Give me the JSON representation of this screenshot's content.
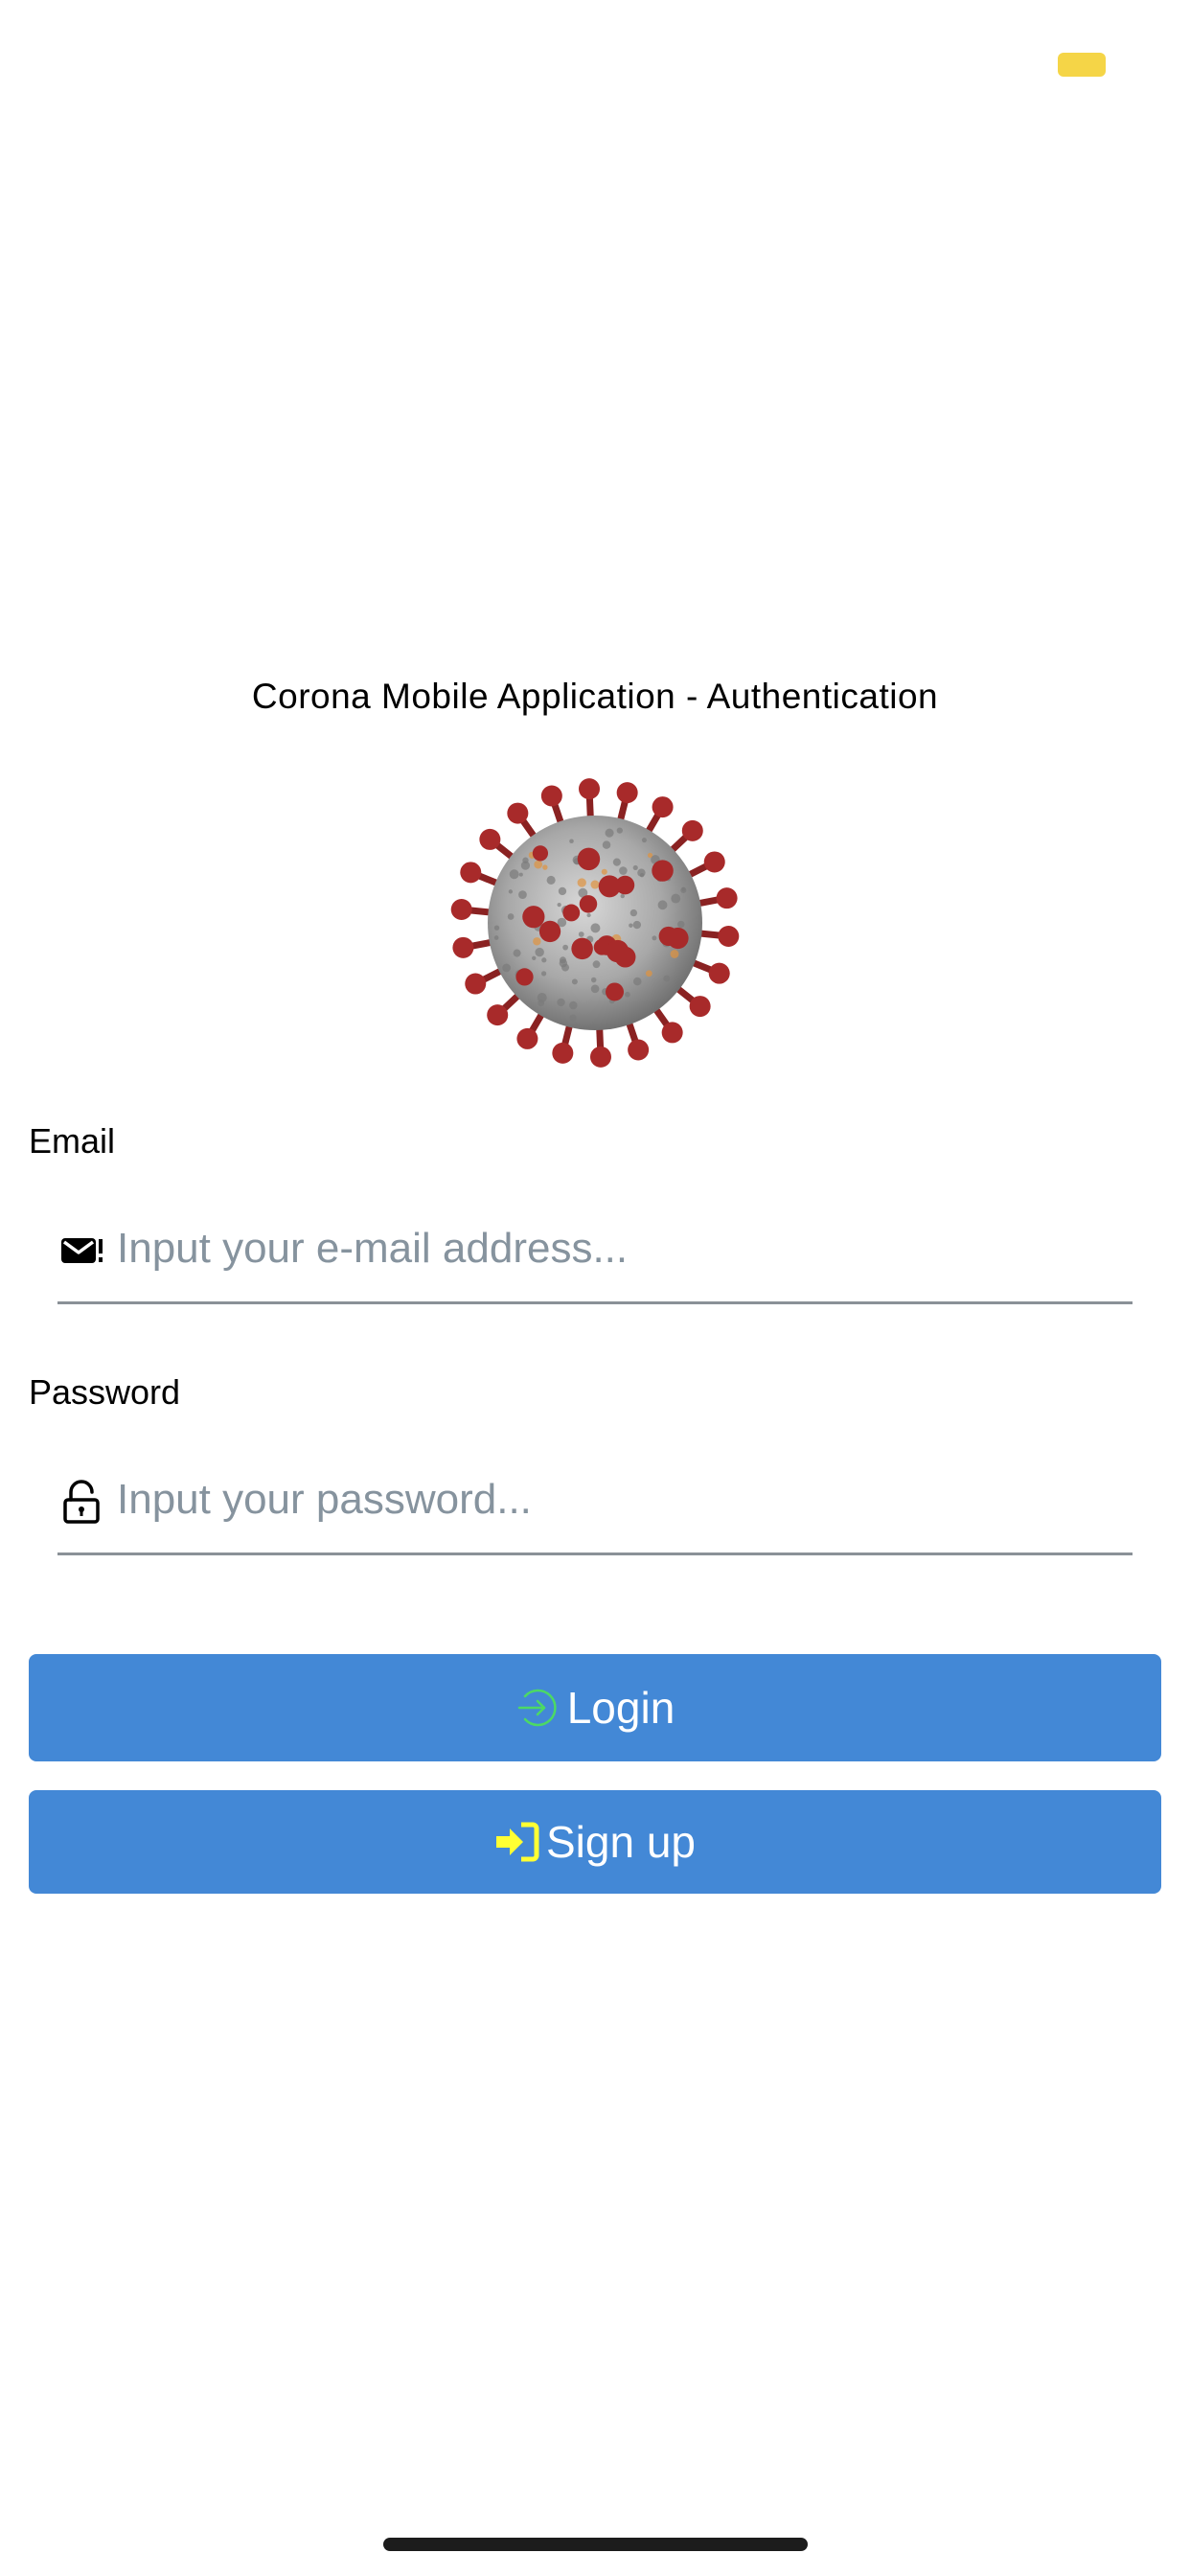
{
  "status_bar": {
    "battery_color": "#f5d547"
  },
  "header": {
    "title": "Corona Mobile Application - Authentication"
  },
  "hero_image": {
    "name": "coronavirus-illustration",
    "colors": {
      "spikes": "#a82a2a",
      "body": "#b9b9b9"
    }
  },
  "form": {
    "email": {
      "label": "Email",
      "placeholder": "Input your e-mail address...",
      "value": "",
      "icon": "email-alert-icon"
    },
    "password": {
      "label": "Password",
      "placeholder": "Input your password...",
      "value": "",
      "icon": "lock-open-icon"
    }
  },
  "actions": {
    "login": {
      "label": "Login",
      "icon": "login-circle-icon",
      "icon_color": "#4cd964"
    },
    "signup": {
      "label": "Sign up",
      "icon": "sign-in-icon",
      "icon_color": "#ffff33"
    }
  },
  "colors": {
    "button_bg": "#4388d6",
    "placeholder": "#86939e",
    "underline": "#8a9197"
  }
}
